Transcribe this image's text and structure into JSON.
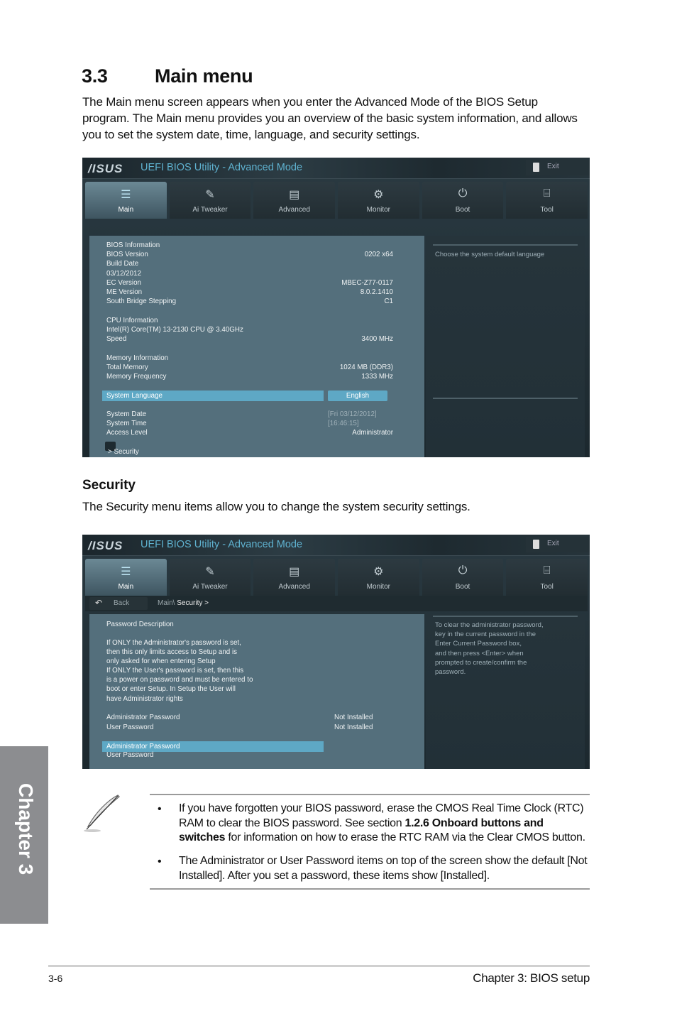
{
  "page": {
    "section_number": "3.3",
    "section_title": "Main menu",
    "intro": "The Main menu screen appears when you enter the Advanced Mode of the BIOS Setup program. The Main menu provides you an overview of the basic system information, and allows you to set the system date, time, language, and security settings.",
    "subsection_title": "Security",
    "subsection_intro": "The Security menu items allow you to change the system security settings.",
    "chapter_tab": "Chapter 3",
    "footer_page": "3-6",
    "footer_chapter": "Chapter 3: BIOS setup"
  },
  "bios_common": {
    "logo": "/ISUS",
    "title": "UEFI BIOS Utility - Advanced Mode",
    "exit_label": "Exit",
    "tabs": [
      {
        "label": "Main",
        "icon": "list-icon",
        "glyph": "☰"
      },
      {
        "label": "Ai  Tweaker",
        "icon": "tweaker-icon",
        "glyph": "✎"
      },
      {
        "label": "Advanced",
        "icon": "advanced-icon",
        "glyph": "▤"
      },
      {
        "label": "Monitor",
        "icon": "monitor-icon",
        "glyph": "⚙"
      },
      {
        "label": "Boot",
        "icon": "power-icon",
        "glyph": "⏻"
      },
      {
        "label": "Tool",
        "icon": "tool-icon",
        "glyph": "⌸"
      }
    ],
    "active_tab": "Main",
    "accent_color": "#5ea8c5"
  },
  "screen1": {
    "rows": [
      {
        "key": "BIOS Information",
        "value": ""
      },
      {
        "key": "BIOS Version",
        "value": "0202 x64"
      },
      {
        "key": "Build Date",
        "value": ""
      },
      {
        "key": "03/12/2012",
        "value": ""
      },
      {
        "key": "EC Version",
        "value": "MBEC-Z77-0117"
      },
      {
        "key": "ME Version",
        "value": "8.0.2.1410"
      },
      {
        "key": "South Bridge Stepping",
        "value": "C1"
      },
      {
        "key": "CPU Information",
        "value": ""
      },
      {
        "key": "Intel(R) Core(TM) 13-2130 CPU @ 3.40GHz",
        "value": ""
      },
      {
        "key": "Speed",
        "value": "3400 MHz"
      },
      {
        "key": "Memory Information",
        "value": ""
      },
      {
        "key": "Total Memory",
        "value": "1024 MB (DDR3)"
      },
      {
        "key": "Memory Frequency",
        "value": "1333 MHz"
      }
    ],
    "language": {
      "label": "System Language",
      "value": "English"
    },
    "date": {
      "label": "System Date",
      "value": "[Fri 03/12/2012]"
    },
    "time": {
      "label": "System Time",
      "value": "[16:46:15]"
    },
    "access": {
      "label": "Access Level",
      "value": "Administrator"
    },
    "submenu": ">  Security",
    "help": "Choose the system default language"
  },
  "screen2": {
    "back_label": "Back",
    "breadcrumb_parent": "Main\\",
    "breadcrumb_current": "Security  >",
    "description_title": "Password Description",
    "description": "If ONLY the Administrator's password is set,\nthen this only limits access to Setup and is\nonly asked for when entering Setup\nIf ONLY the User's password is set, then this\nis a power on password and must be entered to\nboot or enter Setup. In Setup the User will\nhave Administrator rights",
    "admin_status": {
      "label": "Administrator Password",
      "value": "Not Installed"
    },
    "user_status": {
      "label": "User Password",
      "value": "Not Installed"
    },
    "admin_item": "Administrator Password",
    "user_item": "User Password",
    "help": "To clear the administrator password,\nkey in the current password in the\nEnter Current Password box,\nand then press <Enter> when\nprompted to create/confirm the\npassword."
  },
  "note": {
    "icon": "quill-note-icon",
    "bullet": "•",
    "item1_pre": "If you have forgotten your BIOS password, erase the CMOS Real Time Clock (RTC) RAM to clear the BIOS password. See section ",
    "item1_bold": "1.2.6 Onboard buttons and switches",
    "item1_post": " for information on how to erase the RTC RAM via the Clear CMOS button.",
    "item2": "The Administrator or User Password items on top of the screen show the default [Not Installed]. After you set a password, these items show [Installed]."
  }
}
